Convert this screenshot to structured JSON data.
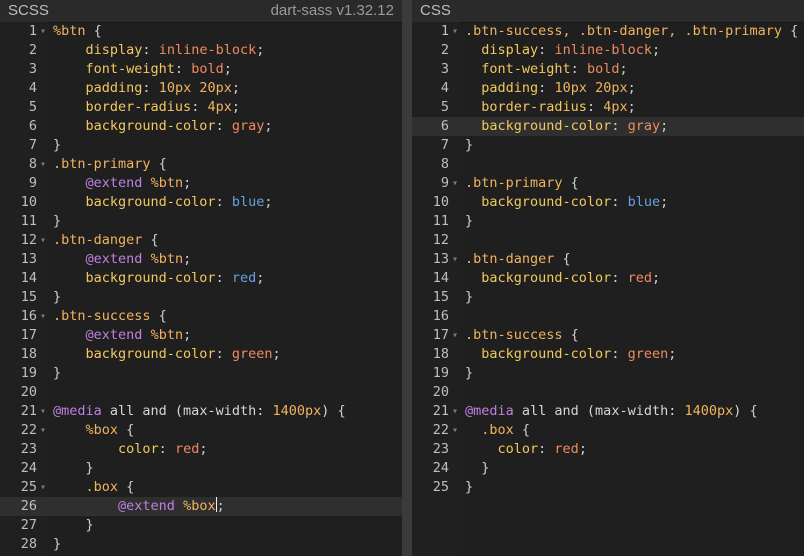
{
  "left_pane": {
    "title": "SCSS",
    "version": "dart-sass v1.32.12",
    "active_line": 26,
    "lines": [
      {
        "n": "1",
        "fold": true,
        "tokens": [
          [
            "sel",
            "%btn"
          ],
          [
            "punc",
            " {"
          ]
        ]
      },
      {
        "n": "2",
        "fold": false,
        "tokens": [
          [
            "plain",
            "    "
          ],
          [
            "prop",
            "display"
          ],
          [
            "punc",
            ": "
          ],
          [
            "val",
            "inline-block"
          ],
          [
            "punc",
            ";"
          ]
        ]
      },
      {
        "n": "3",
        "fold": false,
        "tokens": [
          [
            "plain",
            "    "
          ],
          [
            "prop",
            "font-weight"
          ],
          [
            "punc",
            ": "
          ],
          [
            "val",
            "bold"
          ],
          [
            "punc",
            ";"
          ]
        ]
      },
      {
        "n": "4",
        "fold": false,
        "tokens": [
          [
            "plain",
            "    "
          ],
          [
            "prop",
            "padding"
          ],
          [
            "punc",
            ": "
          ],
          [
            "num",
            "10px 20px"
          ],
          [
            "punc",
            ";"
          ]
        ]
      },
      {
        "n": "5",
        "fold": false,
        "tokens": [
          [
            "plain",
            "    "
          ],
          [
            "prop",
            "border-radius"
          ],
          [
            "punc",
            ": "
          ],
          [
            "num",
            "4px"
          ],
          [
            "punc",
            ";"
          ]
        ]
      },
      {
        "n": "6",
        "fold": false,
        "tokens": [
          [
            "plain",
            "    "
          ],
          [
            "prop",
            "background-color"
          ],
          [
            "punc",
            ": "
          ],
          [
            "val",
            "gray"
          ],
          [
            "punc",
            ";"
          ]
        ]
      },
      {
        "n": "7",
        "fold": false,
        "tokens": [
          [
            "punc",
            "}"
          ]
        ]
      },
      {
        "n": "8",
        "fold": true,
        "tokens": [
          [
            "sel",
            ".btn-primary"
          ],
          [
            "punc",
            " {"
          ]
        ]
      },
      {
        "n": "9",
        "fold": false,
        "tokens": [
          [
            "plain",
            "    "
          ],
          [
            "at",
            "@extend"
          ],
          [
            "plain",
            " "
          ],
          [
            "sel",
            "%btn"
          ],
          [
            "punc",
            ";"
          ]
        ]
      },
      {
        "n": "10",
        "fold": false,
        "tokens": [
          [
            "plain",
            "    "
          ],
          [
            "prop",
            "background-color"
          ],
          [
            "punc",
            ": "
          ],
          [
            "blue",
            "blue"
          ],
          [
            "punc",
            ";"
          ]
        ]
      },
      {
        "n": "11",
        "fold": false,
        "tokens": [
          [
            "punc",
            "}"
          ]
        ]
      },
      {
        "n": "12",
        "fold": true,
        "tokens": [
          [
            "sel",
            ".btn-danger"
          ],
          [
            "punc",
            " {"
          ]
        ]
      },
      {
        "n": "13",
        "fold": false,
        "tokens": [
          [
            "plain",
            "    "
          ],
          [
            "at",
            "@extend"
          ],
          [
            "plain",
            " "
          ],
          [
            "sel",
            "%btn"
          ],
          [
            "punc",
            ";"
          ]
        ]
      },
      {
        "n": "14",
        "fold": false,
        "tokens": [
          [
            "plain",
            "    "
          ],
          [
            "prop",
            "background-color"
          ],
          [
            "punc",
            ": "
          ],
          [
            "blue",
            "red"
          ],
          [
            "punc",
            ";"
          ]
        ]
      },
      {
        "n": "15",
        "fold": false,
        "tokens": [
          [
            "punc",
            "}"
          ]
        ]
      },
      {
        "n": "16",
        "fold": true,
        "tokens": [
          [
            "sel",
            ".btn-success"
          ],
          [
            "punc",
            " {"
          ]
        ]
      },
      {
        "n": "17",
        "fold": false,
        "tokens": [
          [
            "plain",
            "    "
          ],
          [
            "at",
            "@extend"
          ],
          [
            "plain",
            " "
          ],
          [
            "sel",
            "%btn"
          ],
          [
            "punc",
            ";"
          ]
        ]
      },
      {
        "n": "18",
        "fold": false,
        "tokens": [
          [
            "plain",
            "    "
          ],
          [
            "prop",
            "background-color"
          ],
          [
            "punc",
            ": "
          ],
          [
            "val",
            "green"
          ],
          [
            "punc",
            ";"
          ]
        ]
      },
      {
        "n": "19",
        "fold": false,
        "tokens": [
          [
            "punc",
            "}"
          ]
        ]
      },
      {
        "n": "20",
        "fold": false,
        "tokens": []
      },
      {
        "n": "21",
        "fold": true,
        "tokens": [
          [
            "at",
            "@media"
          ],
          [
            "plain",
            " all and (max-width: "
          ],
          [
            "num",
            "1400px"
          ],
          [
            "plain",
            ") "
          ],
          [
            "punc",
            "{"
          ]
        ]
      },
      {
        "n": "22",
        "fold": true,
        "tokens": [
          [
            "plain",
            "    "
          ],
          [
            "sel",
            "%box"
          ],
          [
            "punc",
            " {"
          ]
        ]
      },
      {
        "n": "23",
        "fold": false,
        "tokens": [
          [
            "plain",
            "        "
          ],
          [
            "prop",
            "color"
          ],
          [
            "punc",
            ": "
          ],
          [
            "val",
            "red"
          ],
          [
            "punc",
            ";"
          ]
        ]
      },
      {
        "n": "24",
        "fold": false,
        "tokens": [
          [
            "plain",
            "    "
          ],
          [
            "punc",
            "}"
          ]
        ]
      },
      {
        "n": "25",
        "fold": true,
        "tokens": [
          [
            "plain",
            "    "
          ],
          [
            "sel",
            ".box"
          ],
          [
            "punc",
            " {"
          ]
        ]
      },
      {
        "n": "26",
        "fold": false,
        "tokens": [
          [
            "plain",
            "        "
          ],
          [
            "at",
            "@extend"
          ],
          [
            "plain",
            " "
          ],
          [
            "sel",
            "%box"
          ],
          [
            "caret",
            ""
          ],
          [
            "punc",
            ";"
          ]
        ]
      },
      {
        "n": "27",
        "fold": false,
        "tokens": [
          [
            "plain",
            "    "
          ],
          [
            "punc",
            "}"
          ]
        ]
      },
      {
        "n": "28",
        "fold": false,
        "tokens": [
          [
            "punc",
            "}"
          ]
        ]
      }
    ]
  },
  "right_pane": {
    "title": "CSS",
    "active_line": 6,
    "lines": [
      {
        "n": "1",
        "fold": true,
        "tokens": [
          [
            "sel",
            ".btn-success, .btn-danger, .btn-primary"
          ],
          [
            "punc",
            " {"
          ]
        ]
      },
      {
        "n": "2",
        "fold": false,
        "tokens": [
          [
            "plain",
            "  "
          ],
          [
            "prop",
            "display"
          ],
          [
            "punc",
            ": "
          ],
          [
            "val",
            "inline-block"
          ],
          [
            "punc",
            ";"
          ]
        ]
      },
      {
        "n": "3",
        "fold": false,
        "tokens": [
          [
            "plain",
            "  "
          ],
          [
            "prop",
            "font-weight"
          ],
          [
            "punc",
            ": "
          ],
          [
            "val",
            "bold"
          ],
          [
            "punc",
            ";"
          ]
        ]
      },
      {
        "n": "4",
        "fold": false,
        "tokens": [
          [
            "plain",
            "  "
          ],
          [
            "prop",
            "padding"
          ],
          [
            "punc",
            ": "
          ],
          [
            "num",
            "10px 20px"
          ],
          [
            "punc",
            ";"
          ]
        ]
      },
      {
        "n": "5",
        "fold": false,
        "tokens": [
          [
            "plain",
            "  "
          ],
          [
            "prop",
            "border-radius"
          ],
          [
            "punc",
            ": "
          ],
          [
            "num",
            "4px"
          ],
          [
            "punc",
            ";"
          ]
        ]
      },
      {
        "n": "6",
        "fold": false,
        "tokens": [
          [
            "plain",
            "  "
          ],
          [
            "prop",
            "background-color"
          ],
          [
            "punc",
            ": "
          ],
          [
            "val",
            "gray"
          ],
          [
            "punc",
            ";"
          ]
        ]
      },
      {
        "n": "7",
        "fold": false,
        "tokens": [
          [
            "punc",
            "}"
          ]
        ]
      },
      {
        "n": "8",
        "fold": false,
        "tokens": []
      },
      {
        "n": "9",
        "fold": true,
        "tokens": [
          [
            "sel",
            ".btn-primary"
          ],
          [
            "punc",
            " {"
          ]
        ]
      },
      {
        "n": "10",
        "fold": false,
        "tokens": [
          [
            "plain",
            "  "
          ],
          [
            "prop",
            "background-color"
          ],
          [
            "punc",
            ": "
          ],
          [
            "blue",
            "blue"
          ],
          [
            "punc",
            ";"
          ]
        ]
      },
      {
        "n": "11",
        "fold": false,
        "tokens": [
          [
            "punc",
            "}"
          ]
        ]
      },
      {
        "n": "12",
        "fold": false,
        "tokens": []
      },
      {
        "n": "13",
        "fold": true,
        "tokens": [
          [
            "sel",
            ".btn-danger"
          ],
          [
            "punc",
            " {"
          ]
        ]
      },
      {
        "n": "14",
        "fold": false,
        "tokens": [
          [
            "plain",
            "  "
          ],
          [
            "prop",
            "background-color"
          ],
          [
            "punc",
            ": "
          ],
          [
            "val",
            "red"
          ],
          [
            "punc",
            ";"
          ]
        ]
      },
      {
        "n": "15",
        "fold": false,
        "tokens": [
          [
            "punc",
            "}"
          ]
        ]
      },
      {
        "n": "16",
        "fold": false,
        "tokens": []
      },
      {
        "n": "17",
        "fold": true,
        "tokens": [
          [
            "sel",
            ".btn-success"
          ],
          [
            "punc",
            " {"
          ]
        ]
      },
      {
        "n": "18",
        "fold": false,
        "tokens": [
          [
            "plain",
            "  "
          ],
          [
            "prop",
            "background-color"
          ],
          [
            "punc",
            ": "
          ],
          [
            "val",
            "green"
          ],
          [
            "punc",
            ";"
          ]
        ]
      },
      {
        "n": "19",
        "fold": false,
        "tokens": [
          [
            "punc",
            "}"
          ]
        ]
      },
      {
        "n": "20",
        "fold": false,
        "tokens": []
      },
      {
        "n": "21",
        "fold": true,
        "tokens": [
          [
            "at",
            "@media"
          ],
          [
            "plain",
            " all and (max-width: "
          ],
          [
            "num",
            "1400px"
          ],
          [
            "plain",
            ") "
          ],
          [
            "punc",
            "{"
          ]
        ]
      },
      {
        "n": "22",
        "fold": true,
        "tokens": [
          [
            "plain",
            "  "
          ],
          [
            "sel",
            ".box"
          ],
          [
            "punc",
            " {"
          ]
        ]
      },
      {
        "n": "23",
        "fold": false,
        "tokens": [
          [
            "plain",
            "    "
          ],
          [
            "prop",
            "color"
          ],
          [
            "punc",
            ": "
          ],
          [
            "val",
            "red"
          ],
          [
            "punc",
            ";"
          ]
        ]
      },
      {
        "n": "24",
        "fold": false,
        "tokens": [
          [
            "plain",
            "  "
          ],
          [
            "punc",
            "}"
          ]
        ]
      },
      {
        "n": "25",
        "fold": false,
        "tokens": [
          [
            "punc",
            "}"
          ]
        ]
      }
    ]
  }
}
